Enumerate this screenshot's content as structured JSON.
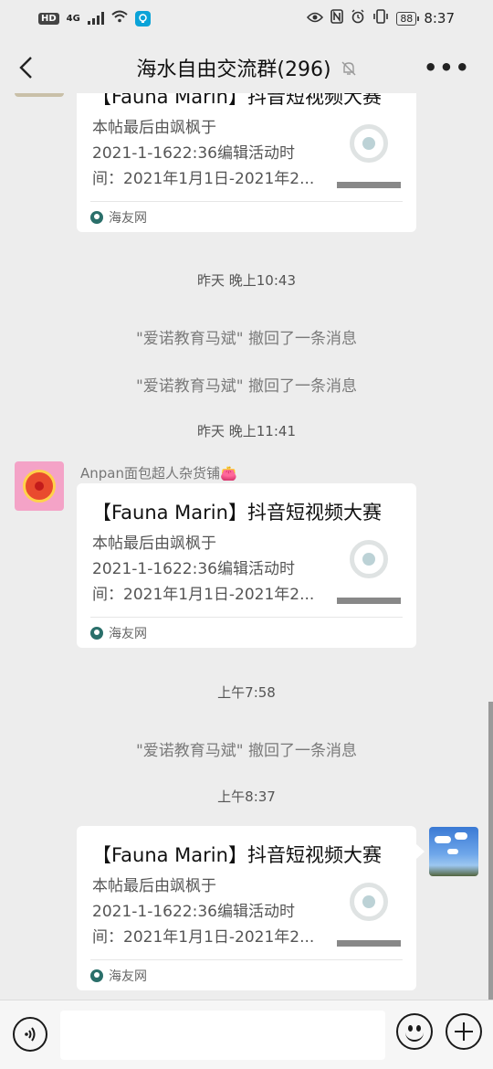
{
  "status_bar": {
    "hd": "HD",
    "network": "4G",
    "battery": "88",
    "time": "8:37"
  },
  "header": {
    "back_icon": "chevron-left-icon",
    "title": "海水自由交流群(296)",
    "mute_icon": "bell-off-icon",
    "more_icon": "more-dots-icon",
    "more_label": "•••"
  },
  "messages": {
    "card_partial": {
      "title": "【Fauna Marin】抖音短视频大赛",
      "line1": "本帖最后由飒枫于",
      "line2": "2021-1-1622:36编辑活动时",
      "line3": "间：2021年1月1日-2021年2...",
      "source": "海友网"
    },
    "time1": "昨天 晚上10:43",
    "recall1": "\"爱诺教育马斌\" 撤回了一条消息",
    "recall2": "\"爱诺教育马斌\" 撤回了一条消息",
    "time2": "昨天 晚上11:41",
    "sender2": "Anpan面包超人杂货铺👛",
    "card2": {
      "title": "【Fauna Marin】抖音短视频大赛",
      "line1": "本帖最后由飒枫于",
      "line2": "2021-1-1622:36编辑活动时",
      "line3": "间：2021年1月1日-2021年2...",
      "source": "海友网"
    },
    "time3": "上午7:58",
    "recall3": "\"爱诺教育马斌\" 撤回了一条消息",
    "time4": "上午8:37",
    "card3": {
      "title": "【Fauna Marin】抖音短视频大赛",
      "line1": "本帖最后由飒枫于",
      "line2": "2021-1-1622:36编辑活动时",
      "line3": "间：2021年1月1日-2021年2...",
      "source": "海友网"
    }
  },
  "input_bar": {
    "voice_icon": "voice-icon",
    "message_value": "",
    "emoji_icon": "emoji-icon",
    "plus_icon": "plus-icon"
  },
  "colors": {
    "chat_bg": "#ededed",
    "card_bg": "#ffffff",
    "source_icon": "#2a6f6a"
  }
}
